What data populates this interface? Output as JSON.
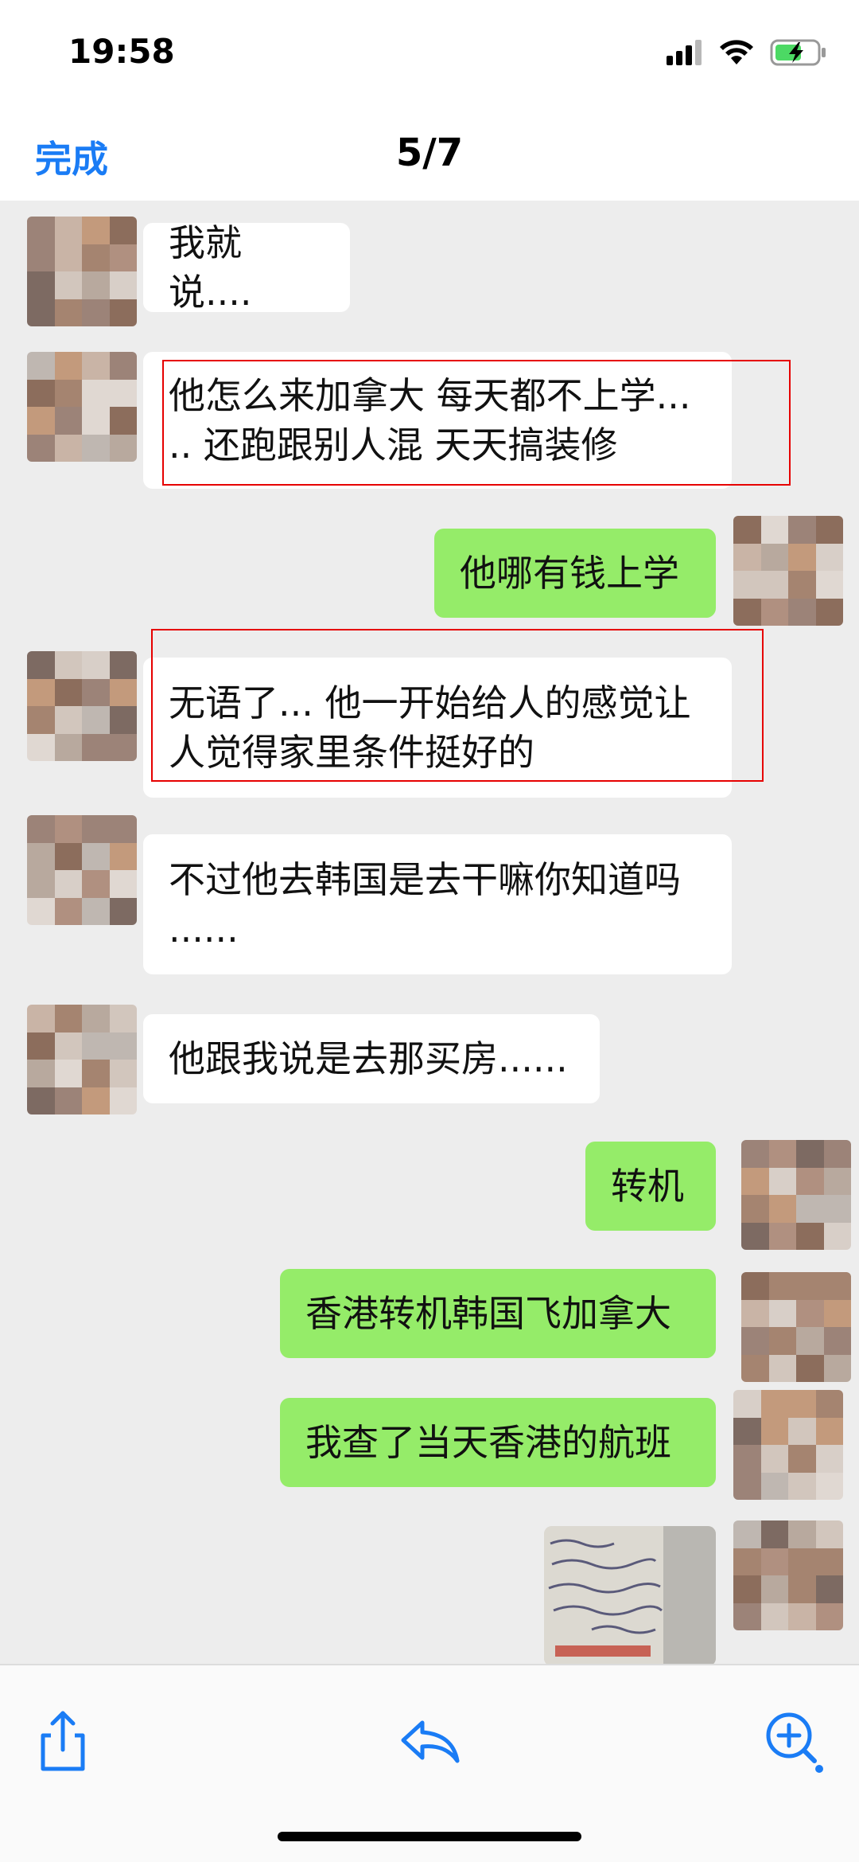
{
  "status_bar": {
    "time": "19:58"
  },
  "nav": {
    "done_label": "完成",
    "page_counter": "5/7"
  },
  "messages": [
    {
      "direction": "incoming",
      "text": "我就说...."
    },
    {
      "direction": "incoming",
      "text": "他怎么来加拿大 每天都不上学...\n.. 还跑跟别人混 天天搞装修",
      "highlighted": true
    },
    {
      "direction": "outgoing",
      "text": "他哪有钱上学"
    },
    {
      "direction": "incoming",
      "text": "无语了... 他一开始给人的感觉让\n人觉得家里条件挺好的",
      "highlighted": true
    },
    {
      "direction": "incoming",
      "text": "不过他去韩国是去干嘛你知道吗\n......"
    },
    {
      "direction": "incoming",
      "text": "他跟我说是去那买房......"
    },
    {
      "direction": "outgoing",
      "text": "转机"
    },
    {
      "direction": "outgoing",
      "text": "香港转机韩国飞加拿大"
    },
    {
      "direction": "outgoing",
      "text": "我查了当天香港的航班"
    },
    {
      "direction": "outgoing",
      "type": "image",
      "description": "handwritten note photo"
    }
  ],
  "toolbar": {
    "share_icon": "share-icon",
    "reply_icon": "reply-icon",
    "zoom_icon": "zoom-in-icon"
  },
  "colors": {
    "outgoing_bubble": "#95ec69",
    "incoming_bubble": "#ffffff",
    "chat_background": "#ededed",
    "accent_blue": "#1a7cf5",
    "highlight_red": "#e60000"
  }
}
